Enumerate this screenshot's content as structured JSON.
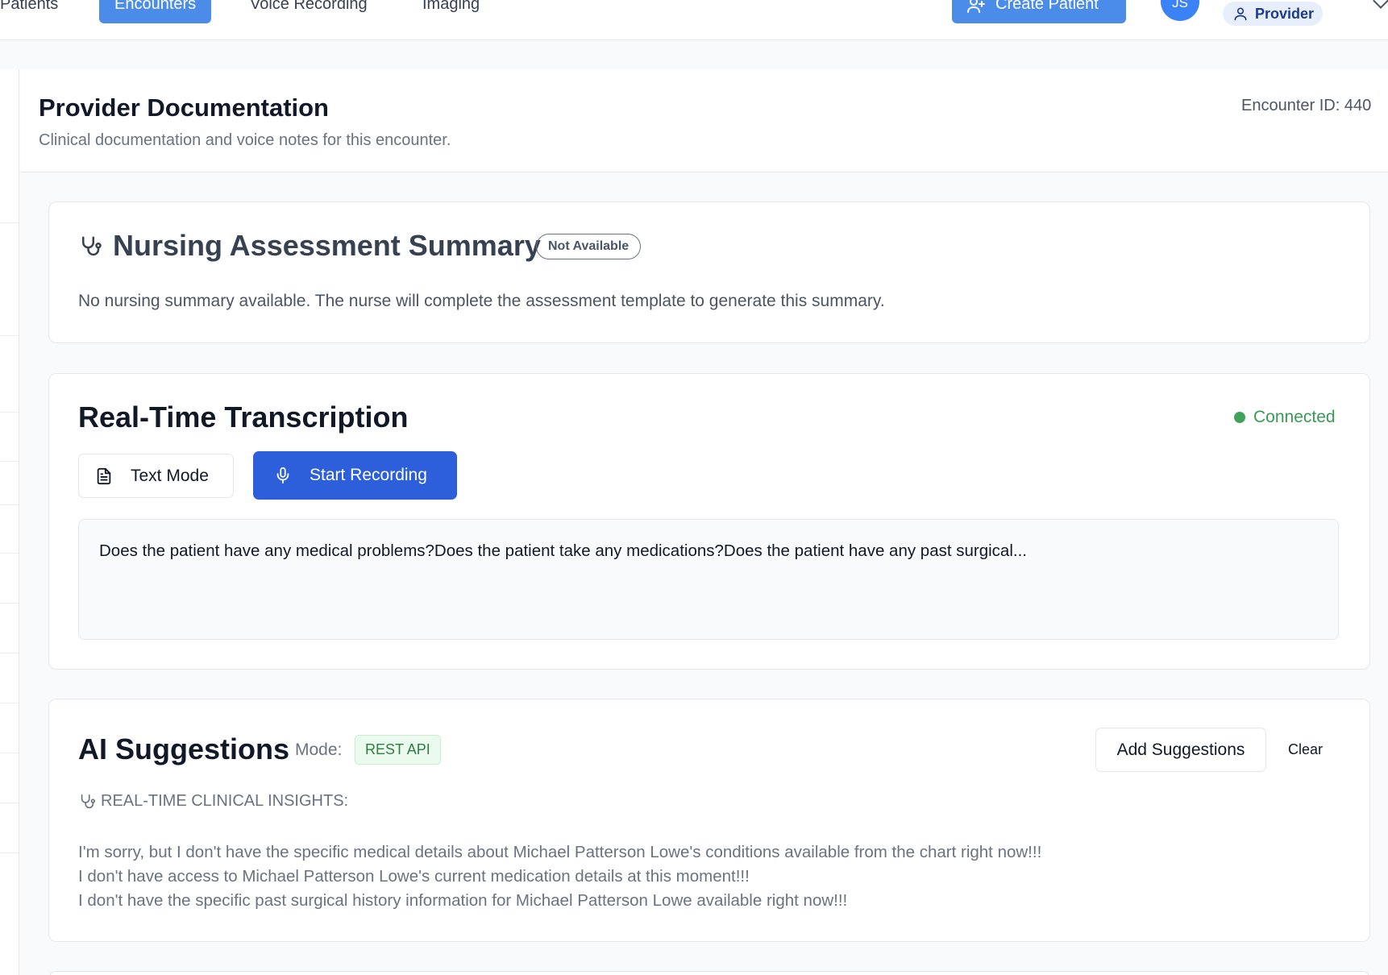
{
  "nav": {
    "items": [
      {
        "label": "Patients",
        "active": false
      },
      {
        "label": "Encounters",
        "active": true
      },
      {
        "label": "Voice Recording",
        "active": false
      },
      {
        "label": "Imaging",
        "active": false
      }
    ],
    "create_patient_label": "Create Patient",
    "create_patient_icon": "user-plus-icon",
    "avatar_initials": "JS",
    "role_label": "Provider",
    "role_icon": "user-icon",
    "menu_icon": "chevron-down-icon"
  },
  "header": {
    "title": "Provider Documentation",
    "subtitle": "Clinical documentation and voice notes for this encounter.",
    "encounter_id": "Encounter ID: 440"
  },
  "nursing_summary": {
    "icon": "stethoscope-icon",
    "title": "Nursing Assessment Summary",
    "badge": "Not Available",
    "message": "No nursing summary available. The nurse will complete the assessment template to generate this summary."
  },
  "transcription": {
    "title": "Real-Time Transcription",
    "status": "Connected",
    "status_color": "#3fa35c",
    "text_mode_label": "Text Mode",
    "text_mode_icon": "document-icon",
    "record_label": "Start Recording",
    "record_icon": "microphone-icon",
    "transcript": "Does the patient have any medical problems?Does the patient take any medications?Does the patient have any past surgical..."
  },
  "ai_suggestions": {
    "title": "AI Suggestions",
    "mode_label": "Mode:",
    "mode_value": "REST API",
    "add_label": "Add Suggestions",
    "clear_label": "Clear",
    "insight_icon": "stethoscope-icon",
    "insight_heading": "REAL-TIME CLINICAL INSIGHTS:",
    "lines": [
      "I'm sorry, but I don't have the specific medical details about Michael Patterson Lowe's conditions available from the chart right now!!!",
      "I don't have access to Michael Patterson Lowe's current medication details at this moment!!!",
      "I don't have the specific past surgical history information for Michael Patterson Lowe available right now!!!"
    ]
  },
  "colors": {
    "accent": "#4a8ce8",
    "primary_button": "#2d5fdb",
    "success": "#3fa35c"
  }
}
